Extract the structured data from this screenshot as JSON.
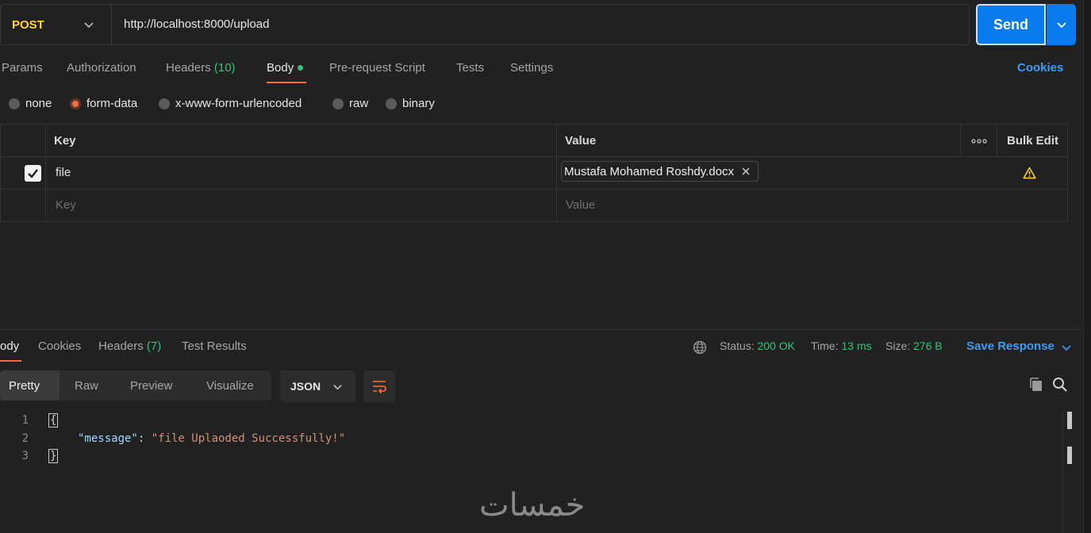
{
  "request": {
    "method": "POST",
    "url": "http://localhost:8000/upload",
    "send_label": "Send"
  },
  "tabs": [
    {
      "label": "Params"
    },
    {
      "label": "Authorization"
    },
    {
      "label": "Headers",
      "count": "(10)"
    },
    {
      "label": "Body"
    },
    {
      "label": "Pre-request Script"
    },
    {
      "label": "Tests"
    },
    {
      "label": "Settings"
    }
  ],
  "cookies_label": "Cookies",
  "body_types": [
    "none",
    "form-data",
    "x-www-form-urlencoded",
    "raw",
    "binary"
  ],
  "body_type_selected": "form-data",
  "form_table": {
    "key_header": "Key",
    "value_header": "Value",
    "bulk_edit": "Bulk Edit",
    "rows": [
      {
        "checked": true,
        "key": "file",
        "value": "Mustafa Mohamed Roshdy.docx"
      }
    ],
    "key_placeholder": "Key",
    "value_placeholder": "Value"
  },
  "response": {
    "tabs": [
      {
        "label": "ody"
      },
      {
        "label": "Cookies"
      },
      {
        "label": "Headers",
        "count": "(7)"
      },
      {
        "label": "Test Results"
      }
    ],
    "status_label": "Status:",
    "status_value": "200 OK",
    "time_label": "Time:",
    "time_value": "13 ms",
    "size_label": "Size:",
    "size_value": "276 B",
    "save_label": "Save Response",
    "views": [
      "Pretty",
      "Raw",
      "Preview",
      "Visualize"
    ],
    "format": "JSON",
    "code": {
      "line_numbers": [
        "1",
        "2",
        "3"
      ],
      "open_brace": "{",
      "key": "\"message\"",
      "colon": ": ",
      "value": "\"file Uplaoded Successfully!\"",
      "close_brace": "}"
    }
  },
  "watermark": "خمسات",
  "colors": {
    "accent": "#ff6c37",
    "primary": "#097bed",
    "link": "#3f9bf5",
    "success": "#35c27a",
    "method": "#ffd43b"
  }
}
